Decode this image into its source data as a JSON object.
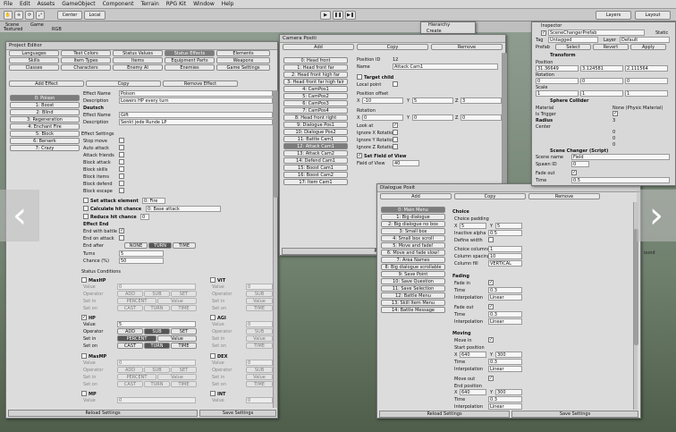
{
  "menubar": {
    "items": [
      "File",
      "Edit",
      "Assets",
      "GameObject",
      "Component",
      "Terrain",
      "RPG Kit",
      "Window",
      "Help"
    ]
  },
  "toolbar": {
    "center": "Center",
    "local": "Local",
    "layers": "Layers",
    "layout": "Layout"
  },
  "toolbar2": {
    "scene": "Scene",
    "game": "Game",
    "textured": "Textured",
    "rgb": "RGB"
  },
  "hierarchy": {
    "title": "Hierarchy",
    "create": "Create"
  },
  "project_editor": {
    "title": "Project Editor",
    "tabs_row1": [
      "Languages",
      "Text Colors",
      "Status Values",
      "Status Effects",
      "Elements"
    ],
    "tabs_row2": [
      "Skills",
      "Item Types",
      "Items",
      "Equipment Parts",
      "Weapons"
    ],
    "tabs_row3": [
      "Classes",
      "Characters",
      "Enemy AI",
      "Enemies",
      "Game Settings"
    ],
    "add": "Add Effect",
    "copy": "Copy",
    "remove": "Remove Effect",
    "effects": [
      "0: Poison",
      "1: Boost",
      "2: Blind",
      "3: Regeneration",
      "4: Enchant Fire",
      "5: Block",
      "6: Berserk",
      "7: Crazy"
    ],
    "effect_name_label": "Effect Name",
    "effect_name": "Poison",
    "desc_label": "Description",
    "desc": "Lowers HP every turn",
    "deutsch": "Deutsch",
    "effect_name_de": "Gift",
    "desc_de": "Senkt jede Runde LP",
    "settings_title": "Effect Settings",
    "settings": [
      "Stop move",
      "Auto attack",
      "Attack friends",
      "Block attack",
      "Block skills",
      "Block items",
      "Block defend",
      "Block escape"
    ],
    "set_attack_element": "Set attack element",
    "set_attack_val": "0: Fire",
    "calc_hit": "Calculate hit chance",
    "calc_hit_val": "0: Base attack",
    "reduce_hit": "Reduce hit chance",
    "reduce_val": "0",
    "effect_end": "Effect End",
    "end_battle": "End with battle",
    "end_attack": "End on attack",
    "end_after": "End after",
    "none": "NONE",
    "turn": "TURN",
    "time": "TIME",
    "turns_label": "Turns",
    "turns": "5",
    "chance_label": "Chance (%)",
    "chance": "50",
    "status_conditions": "Status Conditions",
    "value": "Value",
    "operator": "Operator",
    "setin": "Set in",
    "seton": "Set on",
    "add_op": "ADD",
    "sub_op": "SUB",
    "set_op": "SET",
    "percent": "PERCENT",
    "cast": "CAST",
    "cond_left": [
      "MaxHP",
      "HP",
      "MaxMP",
      "MP"
    ],
    "cond_right": [
      "VIT",
      "AGI",
      "DEX",
      "INT"
    ],
    "hp_value": "5",
    "zero": "0",
    "reload": "Reload Settings",
    "save": "Save Settings"
  },
  "camera": {
    "title": "Camera Positi",
    "add": "Add",
    "copy": "Copy",
    "remove": "Remove",
    "items": [
      "0: Head front",
      "1: Head front far",
      "2: Head front high far",
      "3: Head front far high fair",
      "4: CamPos1",
      "5: CamPos2",
      "6: CamPos3",
      "7: CamPos4",
      "8: Head front right",
      "9: Dialogue Pos1",
      "10: Dialogue Pos2",
      "11: Battle Cam1",
      "12: Attack Cam1",
      "13: Attack Cam2",
      "14: Defend Cam1",
      "15: Boost Cam1",
      "16: Boost Cam2",
      "17: Item Cam1"
    ],
    "pos_id_label": "Position ID",
    "pos_id": "12",
    "name_label": "Name",
    "name": "Attack Cam1",
    "target_child": "Target child",
    "local_point": "Local point",
    "pos_offset": "Position offset",
    "x": "X",
    "y": "Y",
    "z": "Z",
    "px": "-10",
    "py": "5",
    "pz": "3",
    "rotation": "Rotation",
    "rx": "0",
    "ry": "0",
    "rz": "0",
    "look_at": "Look at",
    "ignore_x": "Ignore X Rotatio",
    "ignore_y": "Ignore Y Rotatio",
    "ignore_z": "Ignore Z Rotatio",
    "set_fov": "Set Field of View",
    "fov_label": "Field of View",
    "fov": "40",
    "reload": "Reload Settings"
  },
  "dialogue": {
    "title": "Dialogue Posit",
    "add": "Add",
    "copy": "Copy",
    "remove": "Remove",
    "items": [
      "0: Main Menu",
      "1: Big dialogue",
      "2: Big dialogue no box",
      "3: Small box",
      "4: Small box scroll",
      "5: Move and fade!",
      "6: Move and fade slow!",
      "7: Area Names",
      "8: Big dialogue scrollable",
      "9: Save Point",
      "10: Save Question",
      "11: Save Selection",
      "12: Battle Menu",
      "13: Skill Item Menu",
      "14: Battle Message"
    ],
    "choice": "Choice",
    "choice_padding": "Choice padding",
    "x": "X",
    "y": "Y",
    "cpx": "5",
    "cpy": "5",
    "inactive_alpha": "Inactive alpha",
    "alpha": "0.5",
    "define_width": "Define width",
    "choice_columns": "Choice columns",
    "columns": "1",
    "column_spacing": "Column spacing",
    "spacing": "10",
    "column_fill": "Column fill",
    "fill": "VERTICAL",
    "fading": "Fading",
    "fade_in": "Fade in",
    "time": "Time",
    "t1": "0.3",
    "interp": "Interpolation",
    "linear": "Linear",
    "fade_out": "Fade out",
    "t2": "0.3",
    "moving": "Moving",
    "move_in": "Move in",
    "start_pos": "Start position",
    "sx": "640",
    "sy": "300",
    "t3": "0.3",
    "move_out": "Move out",
    "end_pos": "End position",
    "ex": "640",
    "ey": "300",
    "t4": "0.3",
    "reload": "Reload Settings",
    "save": "Save Settings"
  },
  "inspector": {
    "title": "Inspector",
    "obj": "SceneChangerPrefab",
    "static": "Static",
    "tag": "Tag",
    "tag_val": "Untagged",
    "layer": "Layer",
    "layer_val": "Default",
    "prefab": "Prefab",
    "select": "Select",
    "revert": "Revert",
    "apply": "Apply",
    "transform": "Transform",
    "position": "Position",
    "rotation": "Rotation",
    "scale": "Scale",
    "px": "31.36649",
    "py": "3.124581",
    "pz": "2.111564",
    "rx": "0",
    "ry": "0",
    "rz": "0",
    "sx": "1",
    "sy": "1",
    "sz": "1",
    "sphere": "Sphere Collider",
    "material": "Material",
    "material_val": "None (Physic Material)",
    "is_trigger": "Is Trigger",
    "radius": "Radius",
    "radius_val": "3",
    "center": "Center",
    "cx": "0",
    "cy": "0",
    "cz": "0",
    "script": "Scene Changer (Script)",
    "scene_name": "Scene name",
    "scene_val": "Field",
    "spawn": "Spawn ID",
    "spawn_val": "0",
    "fade_out": "Fade out",
    "time": "Time",
    "time_val": "0.5",
    "round": "ound"
  }
}
